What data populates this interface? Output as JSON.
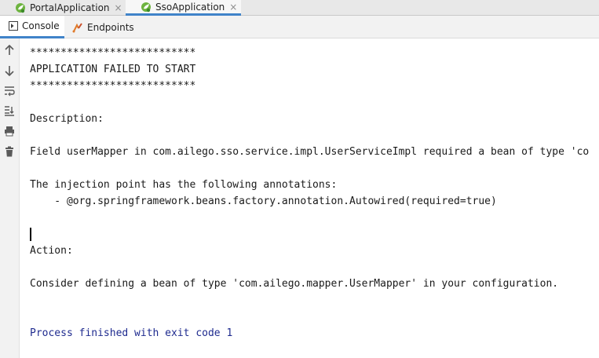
{
  "tabs": [
    {
      "label": "PortalApplication",
      "close": "×",
      "icon": "spring-leaf-icon",
      "active": false
    },
    {
      "label": "SsoApplication",
      "close": "×",
      "icon": "spring-leaf-icon",
      "active": true
    }
  ],
  "toolwindow_tabs": [
    {
      "label": "Console",
      "icon": "console-icon",
      "active": true
    },
    {
      "label": "Endpoints",
      "icon": "endpoints-icon",
      "active": false
    }
  ],
  "sidebar_icons": [
    "up-arrow-icon",
    "down-arrow-icon",
    "soft-wrap-icon",
    "scroll-to-end-icon",
    "print-icon",
    "trash-icon"
  ],
  "console": {
    "lines": {
      "stars1": "***************************",
      "failed": "APPLICATION FAILED TO START",
      "stars2": "***************************",
      "description": "Description:",
      "field": "Field userMapper in com.ailego.sso.service.impl.UserServiceImpl required a bean of type 'co",
      "injection": "The injection point has the following annotations:",
      "annotation": "    - @org.springframework.beans.factory.annotation.Autowired(required=true)",
      "action": "Action:",
      "consider": "Consider defining a bean of type 'com.ailego.mapper.UserMapper' in your configuration.",
      "exit": "Process finished with exit code 1"
    }
  },
  "colors": {
    "accent": "#4083c9",
    "exit_text": "#1f2b8f",
    "spring_green": "#6db33f"
  }
}
